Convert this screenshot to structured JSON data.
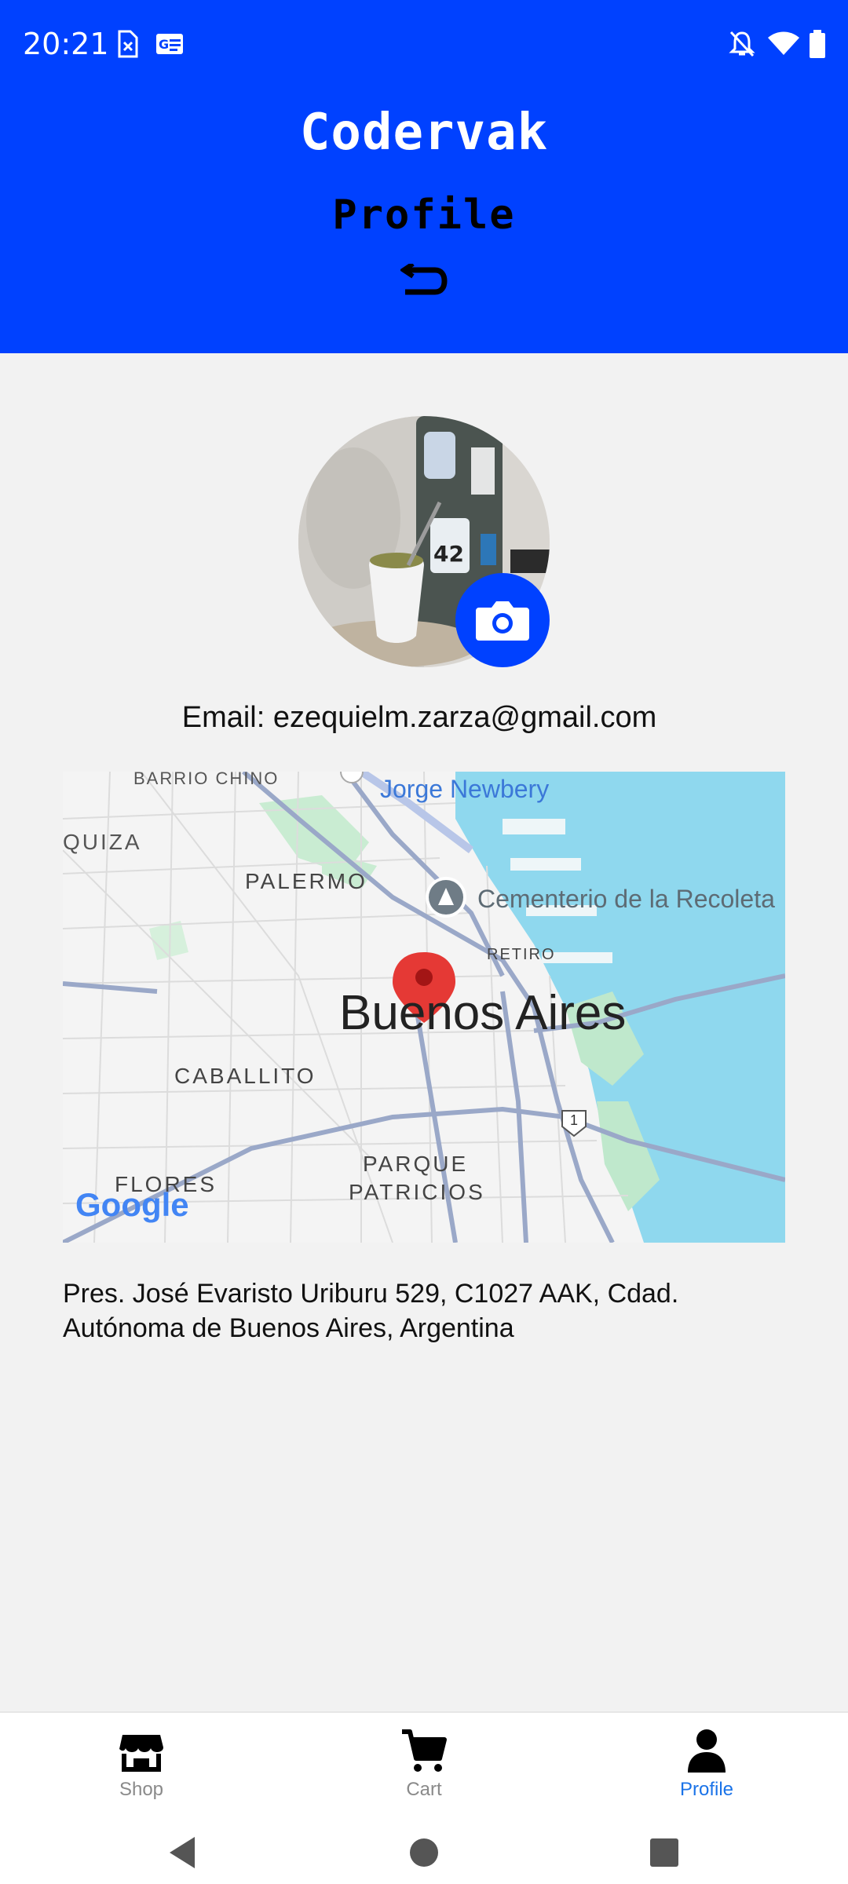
{
  "status_bar": {
    "time": "20:21",
    "left_icons": [
      "sim-off-icon",
      "news-icon"
    ],
    "right_icons": [
      "notifications-off-icon",
      "wifi-icon",
      "battery-icon"
    ]
  },
  "header": {
    "app_title": "Codervak",
    "page_title": "Profile",
    "back_icon": "return-arrow-icon",
    "background_color": "#0041ff"
  },
  "profile": {
    "avatar_icon": "profile-photo",
    "camera_icon": "camera-icon",
    "email": "Email: ezequielm.zarza@gmail.com"
  },
  "map": {
    "labels": {
      "barrio_chino": "BARRIO CHINO",
      "jorge_newbery": "Jorge Newbery",
      "quiza": "QUIZA",
      "palermo": "PALERMO",
      "cementerio": "Cementerio de la Recoleta",
      "retiro": "RETIRO",
      "city": "Buenos Aires",
      "caballito": "CABALLITO",
      "route": "1",
      "parque": "PARQUE",
      "patricios": "PATRICIOS",
      "flores": "FLORES",
      "google": "Google"
    },
    "water_color": "#8fd8ee",
    "marker_color": "#e53935"
  },
  "address": "Pres. José Evaristo Uriburu 529, C1027 AAK, Cdad. Autónoma de Buenos Aires, Argentina",
  "bottom_nav": {
    "items": [
      {
        "label": "Shop",
        "icon": "shop-icon"
      },
      {
        "label": "Cart",
        "icon": "cart-icon"
      },
      {
        "label": "Profile",
        "icon": "person-icon",
        "active": true
      }
    ],
    "active_color": "#1a73e8"
  },
  "system_nav": [
    "back-triangle-icon",
    "home-circle-icon",
    "recents-square-icon"
  ]
}
